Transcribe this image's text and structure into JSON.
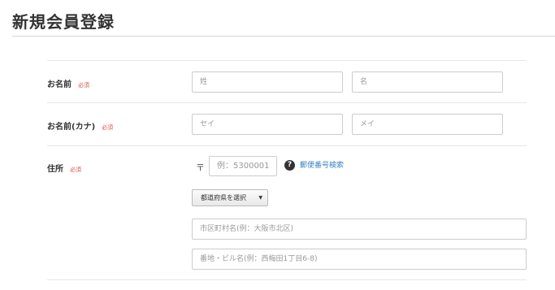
{
  "page": {
    "title": "新規会員登録"
  },
  "required_label": "必須",
  "rows": {
    "name": {
      "label": "お名前",
      "last_placeholder": "姓",
      "first_placeholder": "名"
    },
    "kana": {
      "label": "お名前(カナ)",
      "last_placeholder": "セイ",
      "first_placeholder": "メイ"
    },
    "address": {
      "label": "住所",
      "zip_mark": "〒",
      "zip_placeholder": "例：5300001",
      "help_icon_glyph": "?",
      "zip_lookup_link": "郵便番号検索",
      "prefecture_select": "都道府県を選択",
      "select_caret": "▼",
      "city_placeholder": "市区町村名(例：大阪市北区)",
      "street_placeholder": "番地・ビル名(例：西梅田1丁目6-8)"
    }
  },
  "icons": {
    "help": "question-circle-icon",
    "select": "caret-down-icon"
  }
}
